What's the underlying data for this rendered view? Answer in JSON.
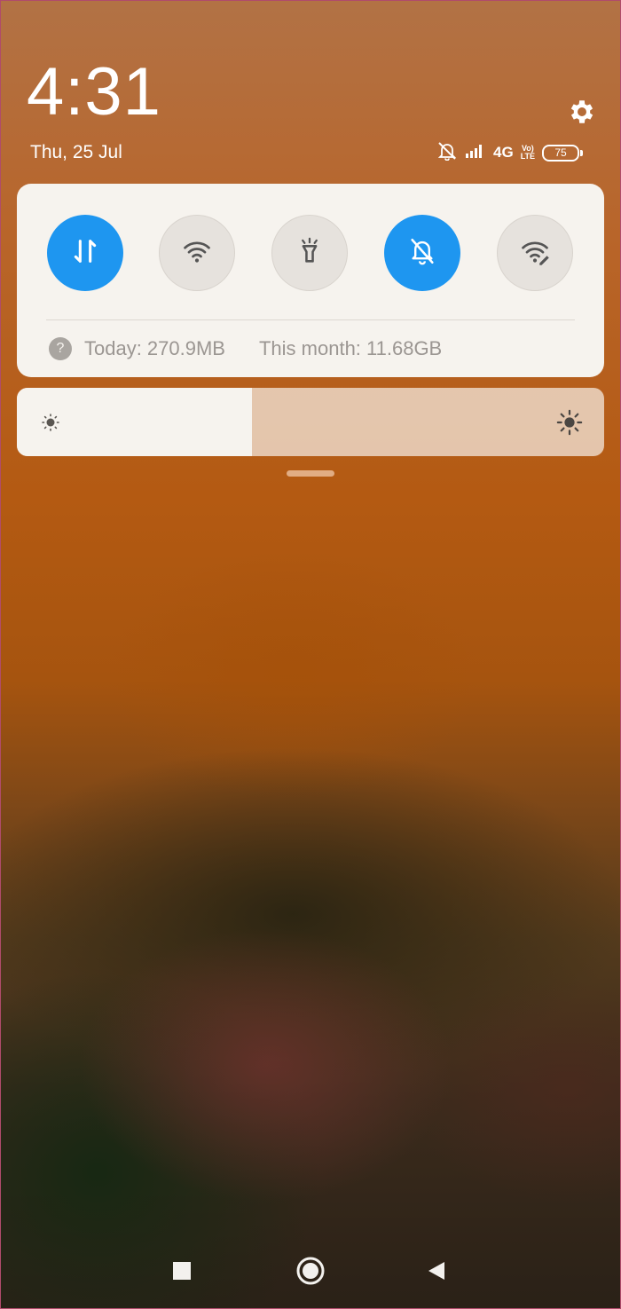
{
  "header": {
    "time": "4:31",
    "date": "Thu, 25 Jul",
    "settings_icon": "gear-icon"
  },
  "status_bar": {
    "icons": [
      "notifications-muted-icon",
      "signal-icon"
    ],
    "network": "4G",
    "volte_top": "Vo)",
    "volte_bottom": "LTE",
    "battery": "75"
  },
  "quick_toggles": [
    {
      "name": "mobile-data",
      "icon": "data-transfer-icon",
      "state": "on"
    },
    {
      "name": "wifi",
      "icon": "wifi-icon",
      "state": "off"
    },
    {
      "name": "flashlight",
      "icon": "flashlight-icon",
      "state": "off"
    },
    {
      "name": "silent",
      "icon": "bell-off-icon",
      "state": "on"
    },
    {
      "name": "hotspot",
      "icon": "wifi-edit-icon",
      "state": "off"
    }
  ],
  "usage": {
    "help_glyph": "?",
    "today": "Today: 270.9MB",
    "month": "This month: 11.68GB"
  },
  "brightness": {
    "level": 0.4
  },
  "navigation": [
    "recents-icon",
    "home-icon",
    "back-icon"
  ],
  "colors": {
    "accent_on": "#1e96f0",
    "toggle_off": "#e6e2dd",
    "panel": "#f6f3ee"
  }
}
